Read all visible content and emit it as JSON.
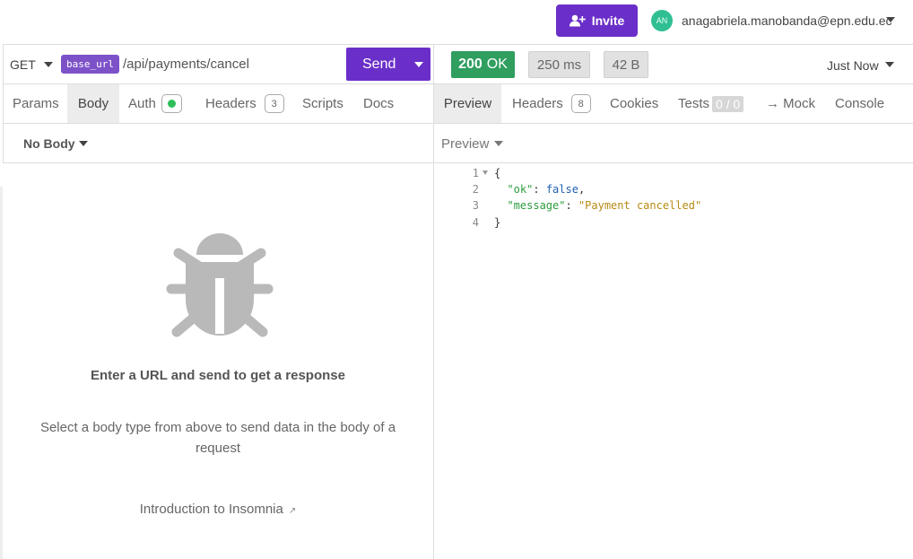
{
  "header": {
    "invite_label": "Invite",
    "user_initials": "AN",
    "user_email": "anagabriela.manobanda@epn.edu.ec"
  },
  "request": {
    "method": "GET",
    "base_url_tag": "base_url",
    "url_path": "/api/payments/cancel",
    "send_label": "Send",
    "tabs": {
      "params": "Params",
      "body": "Body",
      "auth": "Auth",
      "headers": "Headers",
      "headers_count": "3",
      "scripts": "Scripts",
      "docs": "Docs"
    },
    "body_type": "No Body",
    "empty_title": "Enter a URL and send to get a response",
    "empty_description": "Select a body type from above to send data in the body of a request",
    "intro_link": "Introduction to Insomnia"
  },
  "response": {
    "status_code": "200",
    "status_text": "OK",
    "time": "250 ms",
    "size": "42 B",
    "timestamp": "Just Now",
    "tabs": {
      "preview": "Preview",
      "headers": "Headers",
      "headers_count": "8",
      "cookies": "Cookies",
      "tests": "Tests",
      "tests_score": "0 / 0",
      "mock": "→ Mock",
      "console": "Console"
    },
    "preview_mode": "Preview",
    "code": {
      "line_numbers": [
        "1",
        "2",
        "3",
        "4"
      ],
      "open_brace": "{",
      "key_ok": "\"ok\"",
      "val_ok": "false",
      "key_message": "\"message\"",
      "val_message": "\"Payment cancelled\"",
      "close_brace": "}"
    }
  },
  "colors": {
    "accent": "#6b2fc9",
    "status_ok": "#2f9e5f",
    "avatar": "#2fbf93"
  },
  "icons": {
    "invite": "add-user-icon",
    "empty_state": "bug-icon",
    "external_link": "external-link-icon"
  }
}
